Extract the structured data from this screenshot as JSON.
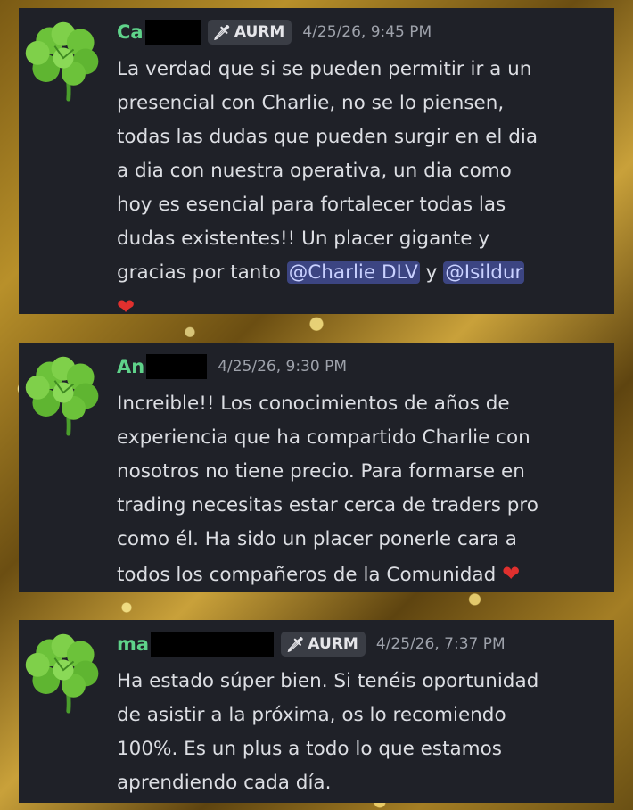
{
  "colors": {
    "card_bg": "#1f2128",
    "name": "#5fd38a",
    "mention_bg": "#3c4582",
    "heart": "#e0302e"
  },
  "messages": [
    {
      "author_visible": "Ca",
      "badge": "AURM",
      "badge_icon": "sword-icon",
      "timestamp": "4/25/26, 9:45 PM",
      "avatar_icon": "clover-icon",
      "text": "La verdad que si se pueden permitir ir a un\npresencial con Charlie, no se lo piensen,\ntodas las dudas que pueden surgir en el dia\na dia con nuestra operativa, un dia como\nhoy es esencial para fortalecer todas las\ndudas existentes!! Un placer gigante y\ngracias por tanto ",
      "mention1": "@Charlie DLV",
      "between": " y ",
      "mention2": "@Isildur",
      "emoji": "heart-emoji"
    },
    {
      "author_visible": "An",
      "timestamp": "4/25/26, 9:30 PM",
      "avatar_icon": "clover-icon",
      "text": "Increible!! Los conocimientos de años de\nexperiencia que ha compartido Charlie con\nnosotros no tiene precio. Para formarse en\ntrading necesitas estar cerca de traders pro\ncomo él. Ha sido un placer ponerle cara a\ntodos los compañeros de la Comunidad ",
      "emoji": "heart-emoji"
    },
    {
      "author_visible": "ma",
      "badge": "AURM",
      "badge_icon": "sword-icon",
      "timestamp": "4/25/26, 7:37 PM",
      "avatar_icon": "clover-icon",
      "text": "Ha estado súper bien. Si tenéis oportunidad\nde asistir a la próxima, os lo recomiendo\n100%. Es un plus a todo lo que estamos\naprendiendo cada día."
    }
  ]
}
